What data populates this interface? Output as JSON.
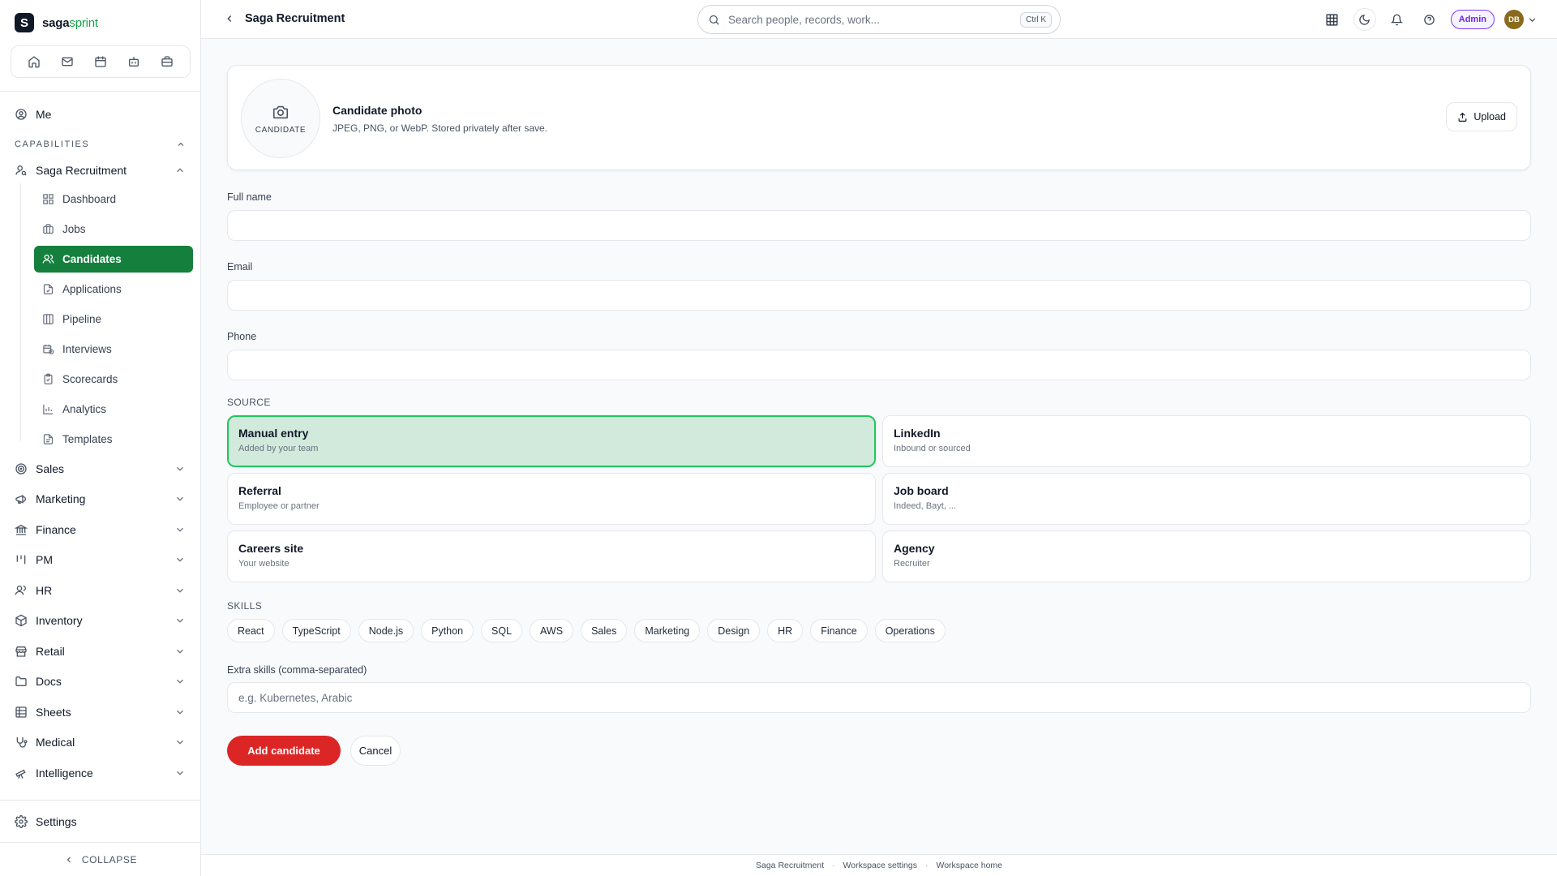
{
  "brand": {
    "name_part1": "saga",
    "name_part2": "sprint",
    "logo_letter": "S"
  },
  "quick_icons": [
    "home-icon",
    "mail-icon",
    "calendar-icon",
    "bot-icon",
    "briefcase-icon"
  ],
  "sidebar": {
    "me_label": "Me",
    "capabilities_label": "CAPABILITIES",
    "recruitment_label": "Saga Recruitment",
    "sub_items": [
      {
        "label": "Dashboard",
        "icon": "dashboard-icon"
      },
      {
        "label": "Jobs",
        "icon": "briefcase-icon"
      },
      {
        "label": "Candidates",
        "icon": "users-icon",
        "active": true
      },
      {
        "label": "Applications",
        "icon": "file-icon"
      },
      {
        "label": "Pipeline",
        "icon": "columns-icon"
      },
      {
        "label": "Interviews",
        "icon": "calendar-clock-icon"
      },
      {
        "label": "Scorecards",
        "icon": "clipboard-icon"
      },
      {
        "label": "Analytics",
        "icon": "bar-chart-icon"
      },
      {
        "label": "Templates",
        "icon": "file-text-icon"
      }
    ],
    "groups": [
      {
        "label": "Sales",
        "icon": "target-icon"
      },
      {
        "label": "Marketing",
        "icon": "megaphone-icon"
      },
      {
        "label": "Finance",
        "icon": "bank-icon"
      },
      {
        "label": "PM",
        "icon": "kanban-icon"
      },
      {
        "label": "HR",
        "icon": "user-group-icon"
      },
      {
        "label": "Inventory",
        "icon": "package-icon"
      },
      {
        "label": "Retail",
        "icon": "store-icon"
      },
      {
        "label": "Docs",
        "icon": "folder-icon"
      },
      {
        "label": "Sheets",
        "icon": "sheet-icon"
      },
      {
        "label": "Medical",
        "icon": "stethoscope-icon"
      },
      {
        "label": "Intelligence",
        "icon": "telescope-icon"
      }
    ],
    "settings_label": "Settings",
    "collapse_label": "COLLAPSE"
  },
  "topbar": {
    "title": "Saga Recruitment",
    "search_placeholder": "Search people, records, work...",
    "search_shortcut": "Ctrl K",
    "admin_label": "Admin",
    "avatar_initials": "DB"
  },
  "photo": {
    "circle_caption": "CANDIDATE",
    "title": "Candidate photo",
    "subtitle": "JPEG, PNG, or WebP. Stored privately after save.",
    "upload_label": "Upload"
  },
  "form": {
    "full_name_label": "Full name",
    "full_name_value": "",
    "email_label": "Email",
    "email_value": "",
    "phone_label": "Phone",
    "phone_value": "",
    "source_label": "SOURCE",
    "sources": [
      {
        "title": "Manual entry",
        "desc": "Added by your team",
        "selected": true
      },
      {
        "title": "LinkedIn",
        "desc": "Inbound or sourced"
      },
      {
        "title": "Referral",
        "desc": "Employee or partner"
      },
      {
        "title": "Job board",
        "desc": "Indeed, Bayt, ..."
      },
      {
        "title": "Careers site",
        "desc": "Your website"
      },
      {
        "title": "Agency",
        "desc": "Recruiter"
      }
    ],
    "skills_label": "SKILLS",
    "skills": [
      "React",
      "TypeScript",
      "Node.js",
      "Python",
      "SQL",
      "AWS",
      "Sales",
      "Marketing",
      "Design",
      "HR",
      "Finance",
      "Operations"
    ],
    "extra_skills_label": "Extra skills (comma-separated)",
    "extra_skills_placeholder": "e.g. Kubernetes, Arabic",
    "submit_label": "Add candidate",
    "cancel_label": "Cancel"
  },
  "footer": {
    "links": [
      "Saga Recruitment",
      "Workspace settings",
      "Workspace home"
    ],
    "separator": "·"
  },
  "colors": {
    "accent_green": "#15803d",
    "primary_red": "#dc2626",
    "admin_purple": "#6d28d9",
    "selected_bg": "#d1eadc"
  }
}
